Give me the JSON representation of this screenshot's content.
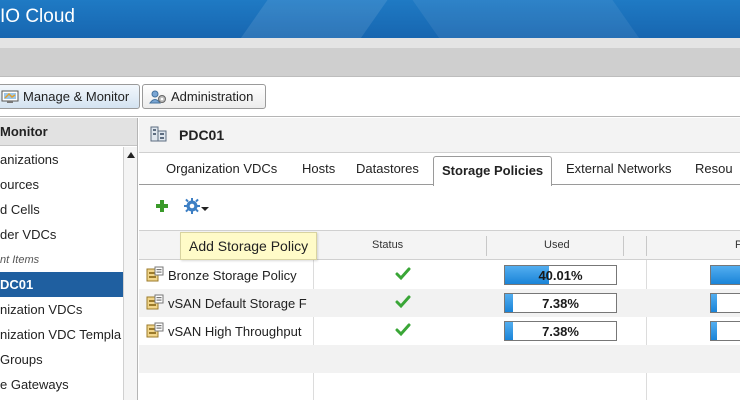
{
  "app": {
    "title": "IO Cloud"
  },
  "top_tabs": [
    {
      "label": "Manage & Monitor",
      "active": true
    },
    {
      "label": "Administration",
      "active": false
    }
  ],
  "left_panel": {
    "header": "Monitor",
    "items": [
      {
        "label": "anizations"
      },
      {
        "label": "ources"
      },
      {
        "label": "d Cells"
      },
      {
        "label": "der VDCs"
      },
      {
        "label": "nt Items",
        "section": true
      },
      {
        "label": "DC01",
        "selected": true
      },
      {
        "label": "nization VDCs"
      },
      {
        "label": "nization VDC Templa"
      },
      {
        "label": "Groups"
      },
      {
        "label": "e Gateways"
      }
    ]
  },
  "main": {
    "title": "PDC01",
    "tabs": [
      {
        "label": "Organization VDCs"
      },
      {
        "label": "Hosts"
      },
      {
        "label": "Datastores"
      },
      {
        "label": "Storage Policies",
        "active": true
      },
      {
        "label": "External Networks"
      },
      {
        "label": "Resou"
      }
    ],
    "toolbar": {
      "add_icon": "plus-icon",
      "actions_icon": "gear-icon"
    },
    "tooltip": "Add Storage Policy",
    "columns": [
      "Status",
      "Used",
      "P"
    ],
    "rows": [
      {
        "name": "Bronze Storage Policy",
        "status": "ok",
        "used": "40.01%",
        "used_fraction": 0.4001
      },
      {
        "name": "vSAN Default Storage F",
        "status": "ok",
        "used": "7.38%",
        "used_fraction": 0.0738
      },
      {
        "name": "vSAN High Throughput",
        "status": "ok",
        "used": "7.38%",
        "used_fraction": 0.0738
      }
    ]
  },
  "colors": {
    "header_blue": "#1766b0",
    "selected_blue": "#1f5fa0",
    "bar_blue": "#1a84d8",
    "check_green": "#3aa637",
    "tooltip_bg": "#fffbc8"
  }
}
